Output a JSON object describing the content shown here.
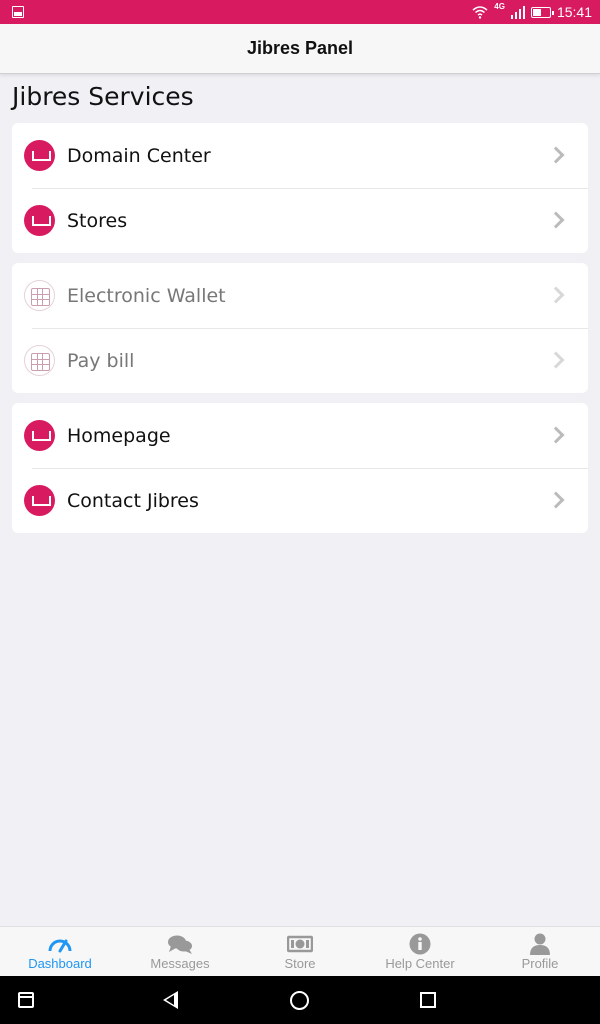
{
  "status_bar": {
    "network": "4G",
    "time": "15:41"
  },
  "app_bar": {
    "title": "Jibres Panel"
  },
  "section": {
    "title": "Jibres Services"
  },
  "groups": [
    {
      "items": [
        {
          "label": "Domain Center",
          "icon": "briefcase-icon"
        },
        {
          "label": "Stores",
          "icon": "briefcase-icon"
        }
      ]
    },
    {
      "items": [
        {
          "label": "Electronic Wallet",
          "icon": "grid-icon"
        },
        {
          "label": "Pay bill",
          "icon": "grid-icon"
        }
      ]
    },
    {
      "items": [
        {
          "label": "Homepage",
          "icon": "briefcase-icon"
        },
        {
          "label": "Contact Jibres",
          "icon": "briefcase-icon"
        }
      ]
    }
  ],
  "tabs": [
    {
      "label": "Dashboard",
      "icon": "speedometer-icon",
      "active": true
    },
    {
      "label": "Messages",
      "icon": "chat-bubbles-icon",
      "active": false
    },
    {
      "label": "Store",
      "icon": "cash-icon",
      "active": false
    },
    {
      "label": "Help Center",
      "icon": "info-icon",
      "active": false
    },
    {
      "label": "Profile",
      "icon": "person-icon",
      "active": false
    }
  ],
  "colors": {
    "accent": "#d81b60",
    "tab_active": "#2196f3",
    "tab_inactive": "#999999",
    "background": "#f0f0f5"
  }
}
